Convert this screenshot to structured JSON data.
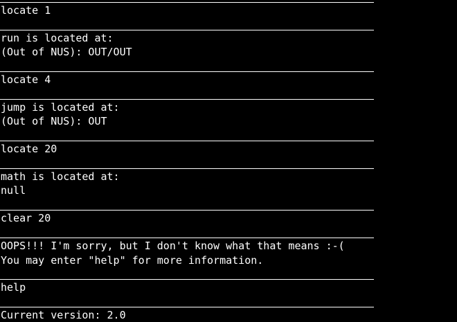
{
  "terminal": {
    "lines": [
      "locate 1",
      "run is located at:",
      "(Out of NUS): OUT/OUT",
      "locate 4",
      "jump is located at:",
      "(Out of NUS): OUT",
      "locate 20",
      "math is located at:",
      "null",
      "clear 20",
      "OOPS!!! I'm sorry, but I don't know what that means :-(",
      "You may enter \"help\" for more information.",
      "help",
      "Current version: 2.0"
    ]
  }
}
